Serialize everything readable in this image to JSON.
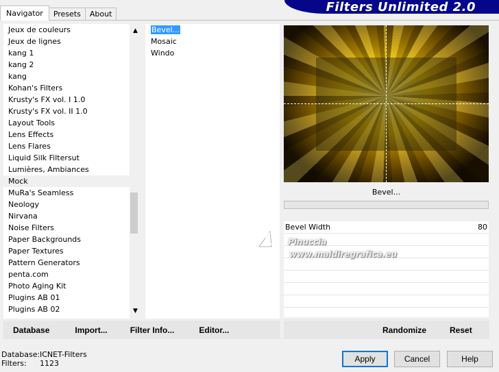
{
  "tabs": [
    {
      "label": "Navigator"
    },
    {
      "label": "Presets"
    },
    {
      "label": "About"
    }
  ],
  "banner": {
    "title": "Filters Unlimited 2.0"
  },
  "categories": {
    "items": [
      "Jeux de couleurs",
      "Jeux de lignes",
      "kang 1",
      "kang 2",
      "kang",
      "Kohan's Filters",
      "Krusty's FX vol. I 1.0",
      "Krusty's FX vol. II 1.0",
      "Layout Tools",
      "Lens Effects",
      "Lens Flares",
      "Liquid Silk Filtersut",
      "Lumières, Ambiances",
      "Mock",
      "MuRa's Seamless",
      "Neology",
      "Nirvana",
      "Noise Filters",
      "Paper Backgrounds",
      "Paper Textures",
      "Pattern Generators",
      "penta.com",
      "Photo Aging Kit",
      "Plugins AB 01",
      "Plugins AB 02"
    ],
    "selected": "Mock"
  },
  "filters": {
    "items": [
      "Bevel...",
      "Mosaic",
      "Windo"
    ],
    "selected": "Bevel..."
  },
  "left_actions": {
    "database": "Database",
    "import": "Import...",
    "filter_info": "Filter Info...",
    "editor": "Editor..."
  },
  "right_actions": {
    "randomize": "Randomize",
    "reset": "Reset"
  },
  "preview": {
    "filter_name": "Bevel...",
    "colors": {
      "bright": "#ffe860",
      "mid": "#e8b800",
      "dark": "#1c1200"
    }
  },
  "params": {
    "rows": [
      {
        "label": "Bevel Width",
        "value": "80"
      },
      {
        "label": "",
        "value": ""
      },
      {
        "label": "",
        "value": ""
      },
      {
        "label": "",
        "value": ""
      },
      {
        "label": "",
        "value": ""
      },
      {
        "label": "",
        "value": ""
      },
      {
        "label": "",
        "value": ""
      },
      {
        "label": "",
        "value": ""
      }
    ]
  },
  "watermark": {
    "line1": "Pinuccia",
    "line2": "www.maldiregrafica.eu"
  },
  "status": {
    "database_label": "Database:",
    "database_value": "ICNET-Filters",
    "filters_label": "Filters:",
    "filters_value": "1123"
  },
  "buttons": {
    "apply": "Apply",
    "cancel": "Cancel",
    "help": "Help"
  }
}
